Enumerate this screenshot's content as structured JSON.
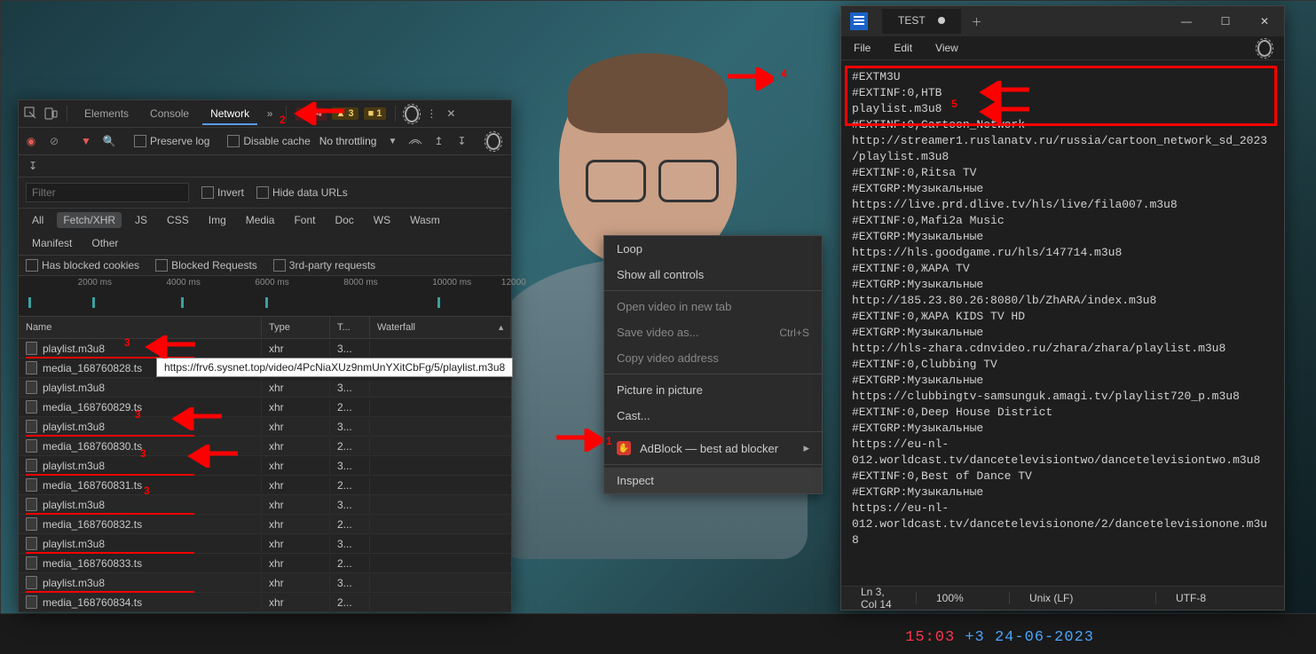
{
  "tv_overlay": {
    "time": "15:03",
    "date_prefix": "+3",
    "date": "24-06-2023"
  },
  "devtools": {
    "tabs": [
      "Elements",
      "Console",
      "Network"
    ],
    "active_tab": "Network",
    "badges": {
      "err": "44",
      "wrn": "3",
      "info": "1"
    },
    "row2": {
      "preserve": "Preserve log",
      "disable_cache": "Disable cache",
      "throttle": "No throttling"
    },
    "filterbar": {
      "placeholder": "Filter",
      "invert": "Invert",
      "hide": "Hide data URLs"
    },
    "filters": [
      "All",
      "Fetch/XHR",
      "JS",
      "CSS",
      "Img",
      "Media",
      "Font",
      "Doc",
      "WS",
      "Wasm",
      "Manifest",
      "Other"
    ],
    "filters_active": "Fetch/XHR",
    "chkrow": {
      "a": "Has blocked cookies",
      "b": "Blocked Requests",
      "c": "3rd-party requests"
    },
    "timeline": [
      {
        "l": "2000 ms",
        "p": 12
      },
      {
        "l": "4000 ms",
        "p": 30
      },
      {
        "l": "6000 ms",
        "p": 48
      },
      {
        "l": "8000 ms",
        "p": 66
      },
      {
        "l": "10000 ms",
        "p": 84
      },
      {
        "l": "12000",
        "p": 98
      }
    ],
    "thead": {
      "name": "Name",
      "type": "Type",
      "time": "T...",
      "wf": "Waterfall"
    },
    "rows": [
      {
        "name": "playlist.m3u8",
        "type": "xhr",
        "time": "3...",
        "wf_l": 2,
        "wf_w": 3,
        "ul": true
      },
      {
        "name": "media_168760828.ts",
        "type": "",
        "time": "",
        "wf_l": 4,
        "wf_w": 0
      },
      {
        "name": "playlist.m3u8",
        "type": "xhr",
        "time": "3...",
        "wf_l": 14,
        "wf_w": 3,
        "ul": false
      },
      {
        "name": "media_168760829.ts",
        "type": "xhr",
        "time": "2...",
        "wf_l": 17,
        "wf_w": 4,
        "ul": false
      },
      {
        "name": "playlist.m3u8",
        "type": "xhr",
        "time": "3...",
        "wf_l": 33,
        "wf_w": 3,
        "ul": true
      },
      {
        "name": "media_168760830.ts",
        "type": "xhr",
        "time": "2...",
        "wf_l": 36,
        "wf_w": 4,
        "ul": false
      },
      {
        "name": "playlist.m3u8",
        "type": "xhr",
        "time": "3...",
        "wf_l": 50,
        "wf_w": 3,
        "ul": true
      },
      {
        "name": "media_168760831.ts",
        "type": "xhr",
        "time": "2...",
        "wf_l": 53,
        "wf_w": 4,
        "ul": false
      },
      {
        "name": "playlist.m3u8",
        "type": "xhr",
        "time": "3...",
        "wf_l": 62,
        "wf_w": 3,
        "ul": true
      },
      {
        "name": "media_168760832.ts",
        "type": "xhr",
        "time": "2...",
        "wf_l": 65,
        "wf_w": 4,
        "ul": false
      },
      {
        "name": "playlist.m3u8",
        "type": "xhr",
        "time": "3...",
        "wf_l": 80,
        "wf_w": 3,
        "ul": true
      },
      {
        "name": "media_168760833.ts",
        "type": "xhr",
        "time": "2...",
        "wf_l": 84,
        "wf_w": 4,
        "ul": false
      },
      {
        "name": "playlist.m3u8",
        "type": "xhr",
        "time": "3...",
        "wf_l": 92,
        "wf_w": 3,
        "ul": true
      },
      {
        "name": "media_168760834.ts",
        "type": "xhr",
        "time": "2...",
        "wf_l": 95,
        "wf_w": 4,
        "ul": false
      }
    ],
    "tooltip": "https://frv6.sysnet.top/video/4PcNiaXUz9nmUnYXitCbFg/5/playlist.m3u8"
  },
  "context_menu": {
    "items": [
      {
        "label": "Loop"
      },
      {
        "label": "Show all controls"
      },
      {
        "div": true
      },
      {
        "label": "Open video in new tab",
        "dim": true
      },
      {
        "label": "Save video as...",
        "sc": "Ctrl+S",
        "dim": true
      },
      {
        "label": "Copy video address",
        "dim": true
      },
      {
        "div": true
      },
      {
        "label": "Picture in picture"
      },
      {
        "label": "Cast..."
      },
      {
        "div": true
      },
      {
        "label": "AdBlock — best ad blocker",
        "sub": true,
        "icon": true
      },
      {
        "div": true
      },
      {
        "label": "Inspect",
        "hl": true
      }
    ]
  },
  "notepad": {
    "tab_title": "TEST",
    "menu": [
      "File",
      "Edit",
      "View"
    ],
    "status": {
      "pos": "Ln 3, Col 14",
      "zoom": "100%",
      "eol": "Unix (LF)",
      "enc": "UTF-8"
    },
    "lines": [
      "#EXTM3U",
      "#EXTINF:0,HTB",
      "playlist.m3u8",
      "#EXTINF:0,Cartoon_Network",
      "http://streamer1.ruslanatv.ru/russia/cartoon_network_sd_2023/playlist.m3u8",
      "#EXTINF:0,Ritsa TV",
      "#EXTGRP:Музыкальные",
      "https://live.prd.dlive.tv/hls/live/fila007.m3u8",
      "#EXTINF:0,Mafi2a Music",
      "#EXTGRP:Музыкальные",
      "https://hls.goodgame.ru/hls/147714.m3u8",
      "#EXTINF:0,ЖАРА TV",
      "#EXTGRP:Музыкальные",
      "http://185.23.80.26:8080/lb/ZhARA/index.m3u8",
      "#EXTINF:0,ЖАРА KIDS TV HD",
      "#EXTGRP:Музыкальные",
      "http://hls-zhara.cdnvideo.ru/zhara/zhara/playlist.m3u8",
      "#EXTINF:0,Clubbing TV",
      "#EXTGRP:Музыкальные",
      "https://clubbingtv-samsunguk.amagi.tv/playlist720_p.m3u8",
      "#EXTINF:0,Deep House District",
      "#EXTGRP:Музыкальные",
      "https://eu-nl-012.worldcast.tv/dancetelevisiontwo/dancetelevisiontwo.m3u8",
      "#EXTINF:0,Best of Dance TV",
      "#EXTGRP:Музыкальные",
      "https://eu-nl-012.worldcast.tv/dancetelevisionone/2/dancetelevisionone.m3u8"
    ]
  },
  "annotations": {
    "arrow2_num": "2",
    "arrow3_num": "3",
    "arrow4_num": "4",
    "arrow5_num": "5",
    "arrow1_num": "1"
  }
}
